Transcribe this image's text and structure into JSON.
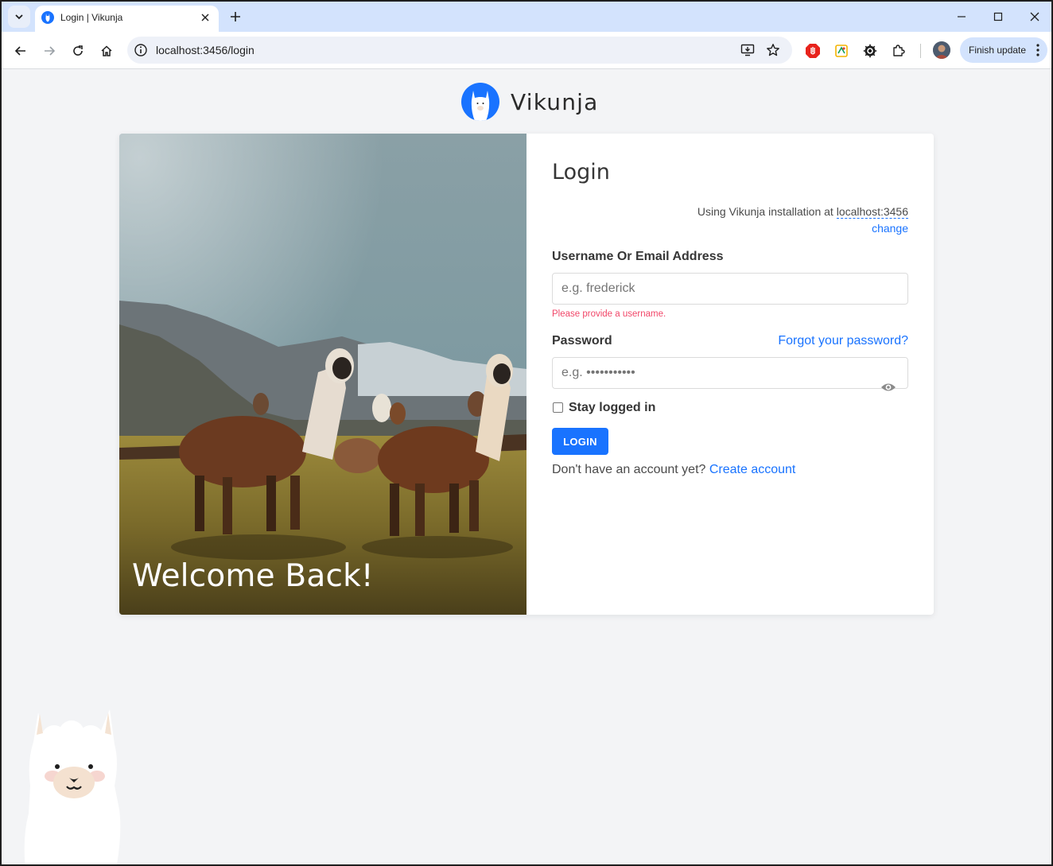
{
  "browser": {
    "tab_title": "Login | Vikunja",
    "url": "localhost:3456/login",
    "finish_update_label": "Finish update"
  },
  "brand": {
    "name": "Vikunja",
    "primary_color": "#1973ff"
  },
  "hero": {
    "welcome_text": "Welcome Back!"
  },
  "login": {
    "title": "Login",
    "install_prefix": "Using Vikunja installation at",
    "install_host": "localhost:3456",
    "change_label": "change",
    "username_label": "Username Or Email Address",
    "username_placeholder": "e.g. frederick",
    "username_error": "Please provide a username.",
    "password_label": "Password",
    "forgot_label": "Forgot your password?",
    "password_placeholder": "e.g. •••••••••••",
    "stay_logged_in_label": "Stay logged in",
    "submit_label": "LOGIN",
    "register_prompt": "Don't have an account yet?",
    "register_label": "Create account"
  },
  "colors": {
    "page_bg": "#f3f4f6",
    "error": "#f14668",
    "tabstrip": "#d3e3fd"
  }
}
